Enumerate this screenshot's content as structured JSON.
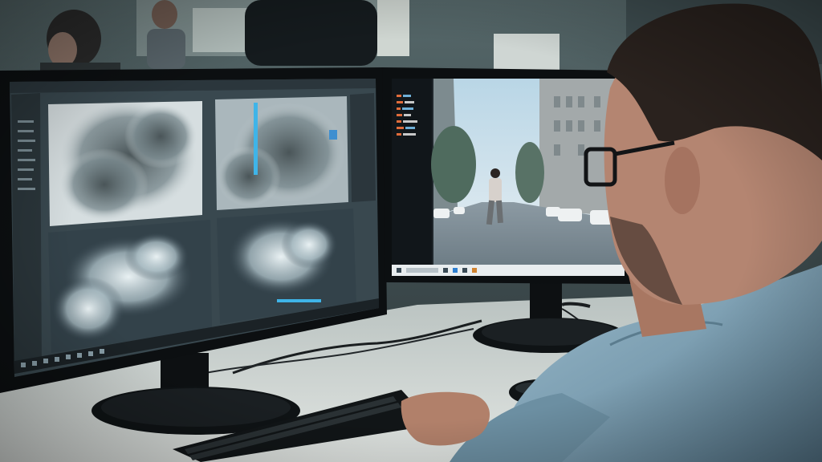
{
  "scene": {
    "description_colors": {
      "room": "#3a4a4e",
      "desk": "#c9cfcd",
      "monitor_bezel": "#0e1113",
      "left_screen_bg": "#3b4b55",
      "right_screen_sky": "#cfe3ef",
      "shirt": "#7fa1b3",
      "skin": "#b98a76",
      "hair": "#2a2420"
    }
  },
  "left_monitor": {
    "taskbar_icons": [
      "start-icon",
      "search-icon",
      "folder-icon",
      "browser-icon",
      "app-icon",
      "app-icon",
      "app-icon",
      "app-icon"
    ]
  },
  "right_monitor": {
    "taskbar_icons": [
      "start-icon",
      "search-icon",
      "folder-icon",
      "browser-icon",
      "app-icon",
      "app-icon"
    ]
  }
}
